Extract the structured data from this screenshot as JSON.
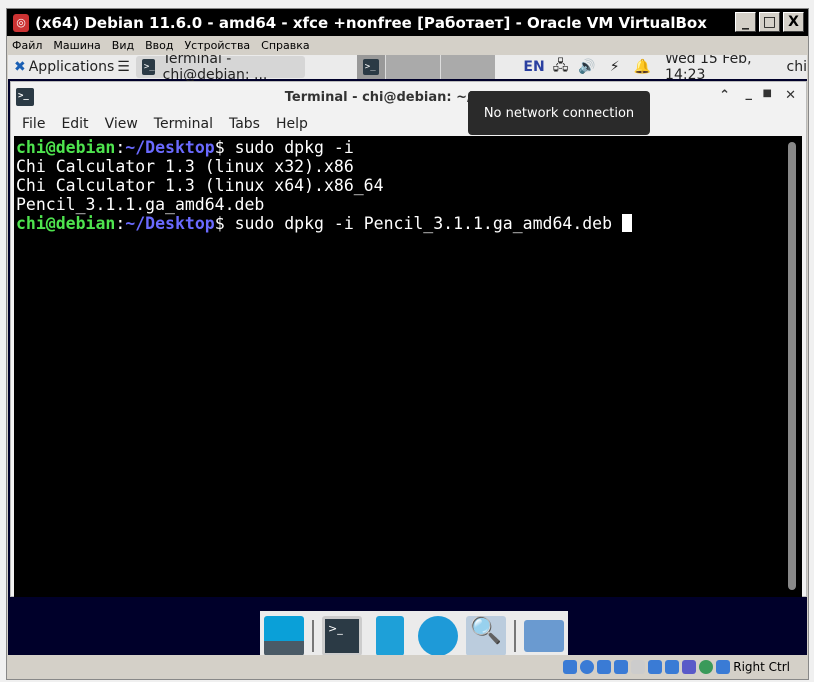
{
  "window": {
    "title": "(x64) Debian 11.6.0 - amd64 - xfce +nonfree [Работает] - Oracle VM VirtualBox",
    "min": "_",
    "max": "□",
    "close": "X"
  },
  "vb_menu": [
    "Файл",
    "Машина",
    "Вид",
    "Ввод",
    "Устройства",
    "Справка"
  ],
  "panel": {
    "applications": "Applications",
    "task": "Terminal - chi@debian: ...",
    "lang": "EN",
    "clock": "Wed 15 Feb, 14:23",
    "user": "chi"
  },
  "terminal": {
    "title": "Terminal - chi@debian: ~/Desktop",
    "menu": [
      "File",
      "Edit",
      "View",
      "Terminal",
      "Tabs",
      "Help"
    ],
    "user_host": "chi@debian",
    "path": "~/Desktop",
    "cmd1": "sudo dpkg -i",
    "out": [
      "Chi Calculator 1.3 (linux x32).x86",
      "Chi Calculator 1.3 (linux x64).x86_64",
      "Pencil_3.1.1.ga_amd64.deb"
    ],
    "cmd2": "sudo dpkg -i Pencil_3.1.1.ga_amd64.deb "
  },
  "tooltip": "No network connection",
  "status": {
    "host_key": "Right Ctrl"
  }
}
